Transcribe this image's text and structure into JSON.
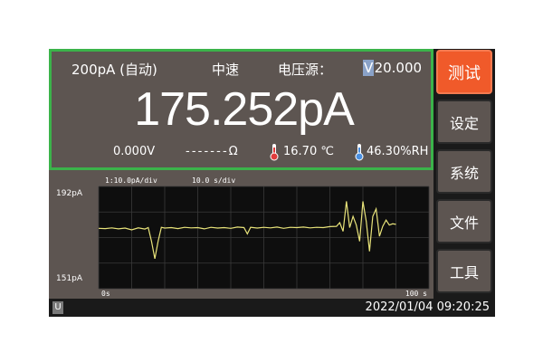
{
  "status": {
    "range": "200pA (自动)",
    "speed": "中速",
    "voltage_source_label": "电压源：",
    "voltage_source_value": "+20.000",
    "voltage_unit": "V"
  },
  "reading": "175.252pA",
  "info": {
    "voltage": "0.000V",
    "resistance": "- - - - - - - Ω",
    "temperature": "16.70 ℃",
    "humidity": "46.30%RH"
  },
  "chart_data": {
    "type": "line",
    "header_left": "1:10.0pA/div",
    "header_right": "10.0 s/div",
    "y_top_label": "192pA",
    "y_bottom_label": "151pA",
    "x_left_label": "0s",
    "x_right_label": "100 s",
    "ylim": [
      151,
      192
    ],
    "xlim": [
      0,
      100
    ],
    "grid": true,
    "series": [
      {
        "values": [
          [
            0,
            175.2
          ],
          [
            2,
            175.1
          ],
          [
            4,
            175.4
          ],
          [
            6,
            175.0
          ],
          [
            8,
            175.3
          ],
          [
            10,
            174.6
          ],
          [
            12,
            175.4
          ],
          [
            14,
            174.9
          ],
          [
            15,
            175.5
          ],
          [
            16,
            170.0
          ],
          [
            17,
            163.0
          ],
          [
            18,
            170.0
          ],
          [
            19,
            175.6
          ],
          [
            20,
            175.3
          ],
          [
            22,
            175.5
          ],
          [
            24,
            175.1
          ],
          [
            26,
            175.6
          ],
          [
            28,
            175.4
          ],
          [
            30,
            175.5
          ],
          [
            32,
            175.0
          ],
          [
            34,
            175.6
          ],
          [
            36,
            175.3
          ],
          [
            38,
            175.5
          ],
          [
            40,
            175.2
          ],
          [
            42,
            175.7
          ],
          [
            44,
            175.5
          ],
          [
            45,
            173.0
          ],
          [
            46,
            175.6
          ],
          [
            48,
            175.3
          ],
          [
            50,
            175.6
          ],
          [
            52,
            175.4
          ],
          [
            54,
            175.7
          ],
          [
            56,
            175.2
          ],
          [
            58,
            175.6
          ],
          [
            60,
            175.5
          ],
          [
            62,
            175.7
          ],
          [
            64,
            175.4
          ],
          [
            66,
            175.6
          ],
          [
            68,
            175.5
          ],
          [
            70,
            175.9
          ],
          [
            72,
            176.0
          ],
          [
            73,
            177.5
          ],
          [
            74,
            174.0
          ],
          [
            75,
            186.0
          ],
          [
            76,
            175.5
          ],
          [
            77,
            180.0
          ],
          [
            78,
            176.5
          ],
          [
            79,
            170.0
          ],
          [
            80,
            186.0
          ],
          [
            81,
            178.0
          ],
          [
            82,
            166.0
          ],
          [
            83,
            180.0
          ],
          [
            84,
            183.0
          ],
          [
            85,
            172.0
          ],
          [
            86,
            176.0
          ],
          [
            87,
            178.5
          ],
          [
            88,
            176.5
          ],
          [
            89,
            177.0
          ],
          [
            90,
            176.8
          ]
        ]
      }
    ]
  },
  "buttons": {
    "test": "测试",
    "settings": "设定",
    "system": "系统",
    "file": "文件",
    "tools": "工具"
  },
  "statusbar": {
    "u_icon": "U",
    "datetime": "2022/01/04 09:20:25"
  },
  "colors": {
    "accent_green": "#3bb34a",
    "active_button": "#f05a2a",
    "trace": "#e8e37a"
  }
}
